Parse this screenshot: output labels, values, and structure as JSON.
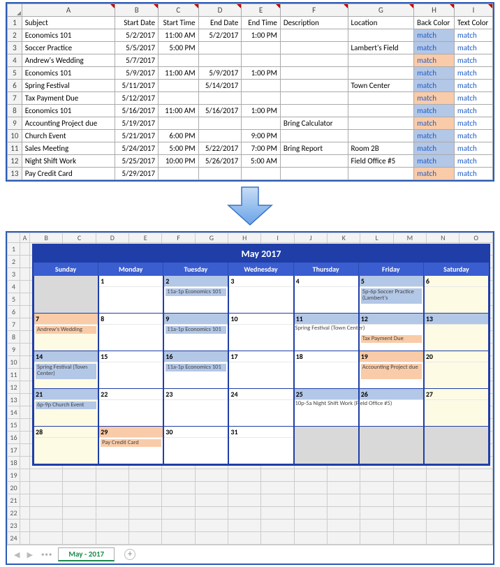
{
  "top": {
    "cols": [
      "A",
      "B",
      "C",
      "D",
      "E",
      "F",
      "G",
      "H",
      "I"
    ],
    "headers": {
      "subject": "Subject",
      "start_date": "Start Date",
      "start_time": "Start Time",
      "end_date": "End Date",
      "end_time": "End Time",
      "description": "Description",
      "location": "Location",
      "back_color": "Back Color",
      "text_color": "Text Color"
    },
    "rows": [
      {
        "n": 2,
        "subject": "Economics 101",
        "start_date": "5/2/2017",
        "start_time": "11:00 AM",
        "end_date": "5/2/2017",
        "end_time": "1:00 PM",
        "description": "",
        "location": "",
        "back": "blue",
        "match1": "match",
        "match2": "match"
      },
      {
        "n": 3,
        "subject": "Soccer Practice",
        "start_date": "5/5/2017",
        "start_time": "5:00 PM",
        "end_date": "",
        "end_time": "",
        "description": "",
        "location": "Lambert's Field",
        "back": "blue",
        "match1": "match",
        "match2": "match"
      },
      {
        "n": 4,
        "subject": "Andrew's Wedding",
        "start_date": "5/7/2017",
        "start_time": "",
        "end_date": "",
        "end_time": "",
        "description": "",
        "location": "",
        "back": "org",
        "match1": "match",
        "match2": "match"
      },
      {
        "n": 5,
        "subject": "Economics 101",
        "start_date": "5/9/2017",
        "start_time": "11:00 AM",
        "end_date": "5/9/2017",
        "end_time": "1:00 PM",
        "description": "",
        "location": "",
        "back": "blue",
        "match1": "match",
        "match2": "match"
      },
      {
        "n": 6,
        "subject": "Spring Festival",
        "start_date": "5/11/2017",
        "start_time": "",
        "end_date": "5/14/2017",
        "end_time": "",
        "description": "",
        "location": "Town Center",
        "back": "blue",
        "match1": "match",
        "match2": "match"
      },
      {
        "n": 7,
        "subject": "Tax Payment Due",
        "start_date": "5/12/2017",
        "start_time": "",
        "end_date": "",
        "end_time": "",
        "description": "",
        "location": "",
        "back": "org",
        "match1": "match",
        "match2": "match"
      },
      {
        "n": 8,
        "subject": "Economics 101",
        "start_date": "5/16/2017",
        "start_time": "11:00 AM",
        "end_date": "5/16/2017",
        "end_time": "1:00 PM",
        "description": "",
        "location": "",
        "back": "blue",
        "match1": "match",
        "match2": "match"
      },
      {
        "n": 9,
        "subject": "Accounting Project due",
        "start_date": "5/19/2017",
        "start_time": "",
        "end_date": "",
        "end_time": "",
        "description": "Bring Calculator",
        "location": "",
        "back": "org",
        "match1": "match",
        "match2": "match"
      },
      {
        "n": 10,
        "subject": "Church Event",
        "start_date": "5/21/2017",
        "start_time": "6:00 PM",
        "end_date": "",
        "end_time": "9:00 PM",
        "description": "",
        "location": "",
        "back": "blue",
        "match1": "match",
        "match2": "match"
      },
      {
        "n": 11,
        "subject": "Sales Meeting",
        "start_date": "5/24/2017",
        "start_time": "5:00 PM",
        "end_date": "5/22/2017",
        "end_time": "7:00 PM",
        "description": "Bring Report",
        "location": "Room 2B",
        "back": "blue",
        "match1": "match",
        "match2": "match"
      },
      {
        "n": 12,
        "subject": "Night Shift Work",
        "start_date": "5/25/2017",
        "start_time": "10:00 PM",
        "end_date": "5/26/2017",
        "end_time": "5:00 AM",
        "description": "",
        "location": "Field Office #5",
        "back": "blue",
        "match1": "match",
        "match2": "match"
      },
      {
        "n": 13,
        "subject": "Pay Credit Card",
        "start_date": "5/29/2017",
        "start_time": "",
        "end_date": "",
        "end_time": "",
        "description": "",
        "location": "",
        "back": "org",
        "match1": "match",
        "match2": "match"
      }
    ]
  },
  "cal": {
    "title": "May 2017",
    "cols": [
      "A",
      "B",
      "C",
      "D",
      "E",
      "F",
      "G",
      "H",
      "I",
      "J",
      "K",
      "L",
      "M",
      "N",
      "O"
    ],
    "rownums_count": 24,
    "days": [
      "Sunday",
      "Monday",
      "Tuesday",
      "Wednesday",
      "Thursday",
      "Friday",
      "Saturday"
    ],
    "tab": "May - 2017",
    "events": {
      "d2": {
        "label": "11a-1p Economics 101",
        "cls": "blue"
      },
      "d5a": {
        "label": "5p-6p Soccer Practice (Lambert's",
        "cls": "blue"
      },
      "d7": {
        "label": "Andrew's Wedding",
        "cls": "org"
      },
      "d9": {
        "label": "11a-1p Economics 101",
        "cls": "blue"
      },
      "d11": {
        "label": "Spring Festival (Town Center)",
        "cls": "blue"
      },
      "d12": {
        "label": "Tax Payment Due",
        "cls": "org"
      },
      "d14": {
        "label": "Spring Festival (Town Center)",
        "cls": "blue"
      },
      "d16": {
        "label": "11a-1p Economics 101",
        "cls": "blue"
      },
      "d19": {
        "label": "Accounting Project due",
        "cls": "org"
      },
      "d21": {
        "label": "6p-9p Church Event",
        "cls": "blue"
      },
      "d25": {
        "label": "10p-5a Night Shift Work (Field Office #5)",
        "cls": "blue"
      },
      "d29": {
        "label": "Pay Credit Card",
        "cls": "org"
      }
    }
  }
}
